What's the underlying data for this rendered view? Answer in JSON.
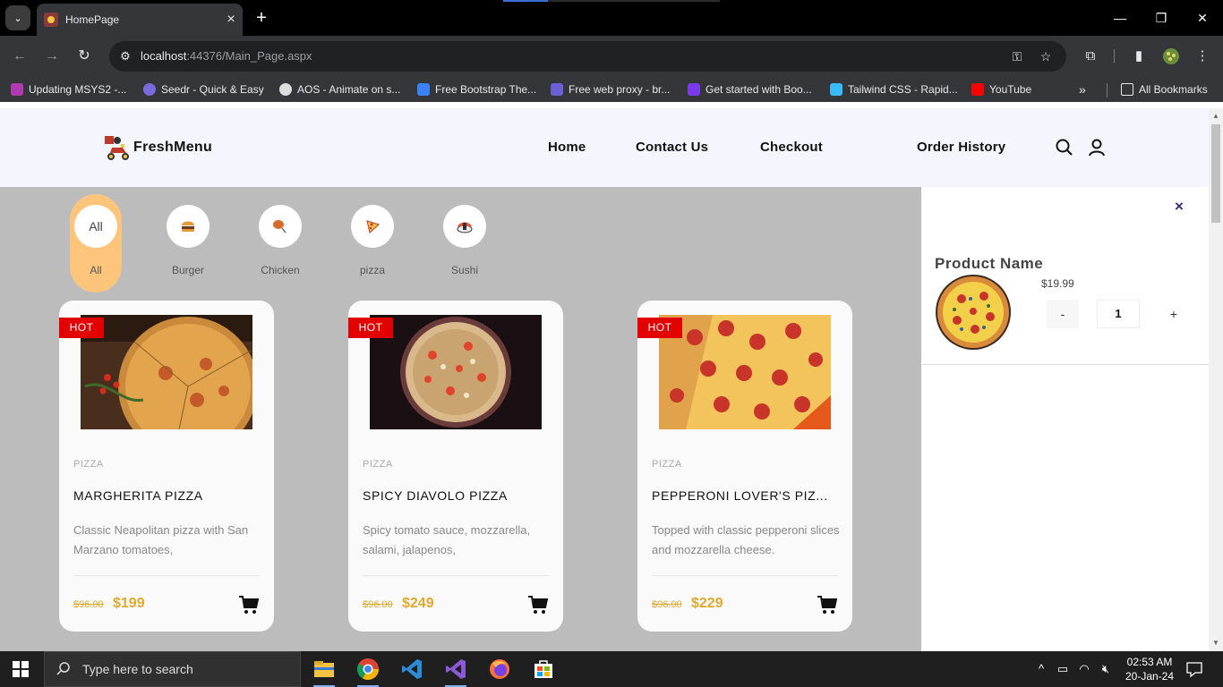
{
  "browser": {
    "tab_title": "HomePage",
    "url_host": "localhost",
    "url_rest": ":44376/Main_Page.aspx",
    "bookmarks": [
      {
        "label": "Updating MSYS2 -...",
        "color": "#b03ab0"
      },
      {
        "label": "Seedr - Quick & Easy",
        "color": "#7a6adf"
      },
      {
        "label": "AOS - Animate on s...",
        "color": "#dddddd"
      },
      {
        "label": "Free Bootstrap The...",
        "color": "#3b82f6"
      },
      {
        "label": "Free web proxy - br...",
        "color": "#6b5fd8"
      },
      {
        "label": "Get started with Boo...",
        "color": "#7c3aed"
      },
      {
        "label": "Tailwind CSS - Rapid...",
        "color": "#38bdf8"
      },
      {
        "label": "YouTube",
        "color": "#ff0000"
      }
    ],
    "more_bookmarks": "»",
    "all_bookmarks": "All Bookmarks"
  },
  "site": {
    "logo_text": "FreshMenu",
    "nav": [
      "Home",
      "Contact Us",
      "Checkout",
      "Order History"
    ]
  },
  "categories": [
    {
      "label": "All",
      "circle_text": "All",
      "active": true
    },
    {
      "label": "Burger",
      "icon": "burger-icon"
    },
    {
      "label": "Chicken",
      "icon": "chicken-icon"
    },
    {
      "label": "pizza",
      "icon": "pizza-icon"
    },
    {
      "label": "Sushi",
      "icon": "sushi-icon"
    }
  ],
  "products": [
    {
      "badge": "HOT",
      "category": "PIZZA",
      "title": "MARGHERITA PIZZA",
      "desc": "Classic Neapolitan pizza with San Marzano tomatoes,",
      "old_price": "$96.00",
      "price": "$199"
    },
    {
      "badge": "HOT",
      "category": "PIZZA",
      "title": "SPICY DIAVOLO PIZZA",
      "desc": "Spicy tomato sauce, mozzarella, salami, jalapenos,",
      "old_price": "$96.00",
      "price": "$249"
    },
    {
      "badge": "HOT",
      "category": "PIZZA",
      "title": "PEPPERONI LOVER'S PIZ...",
      "desc": "Topped with classic pepperoni slices and mozzarella cheese.",
      "old_price": "$96.00",
      "price": "$229"
    }
  ],
  "cart_panel": {
    "close": "×",
    "product_name": "Product Name",
    "price": "$19.99",
    "minus": "-",
    "qty": "1",
    "plus": "+"
  },
  "taskbar": {
    "search_placeholder": "Type here to search",
    "time": "02:53 AM",
    "date": "20-Jan-24"
  },
  "colors": {
    "accent": "#e0a82e",
    "hot_badge": "#e30000",
    "active_category": "#fdc57b"
  }
}
